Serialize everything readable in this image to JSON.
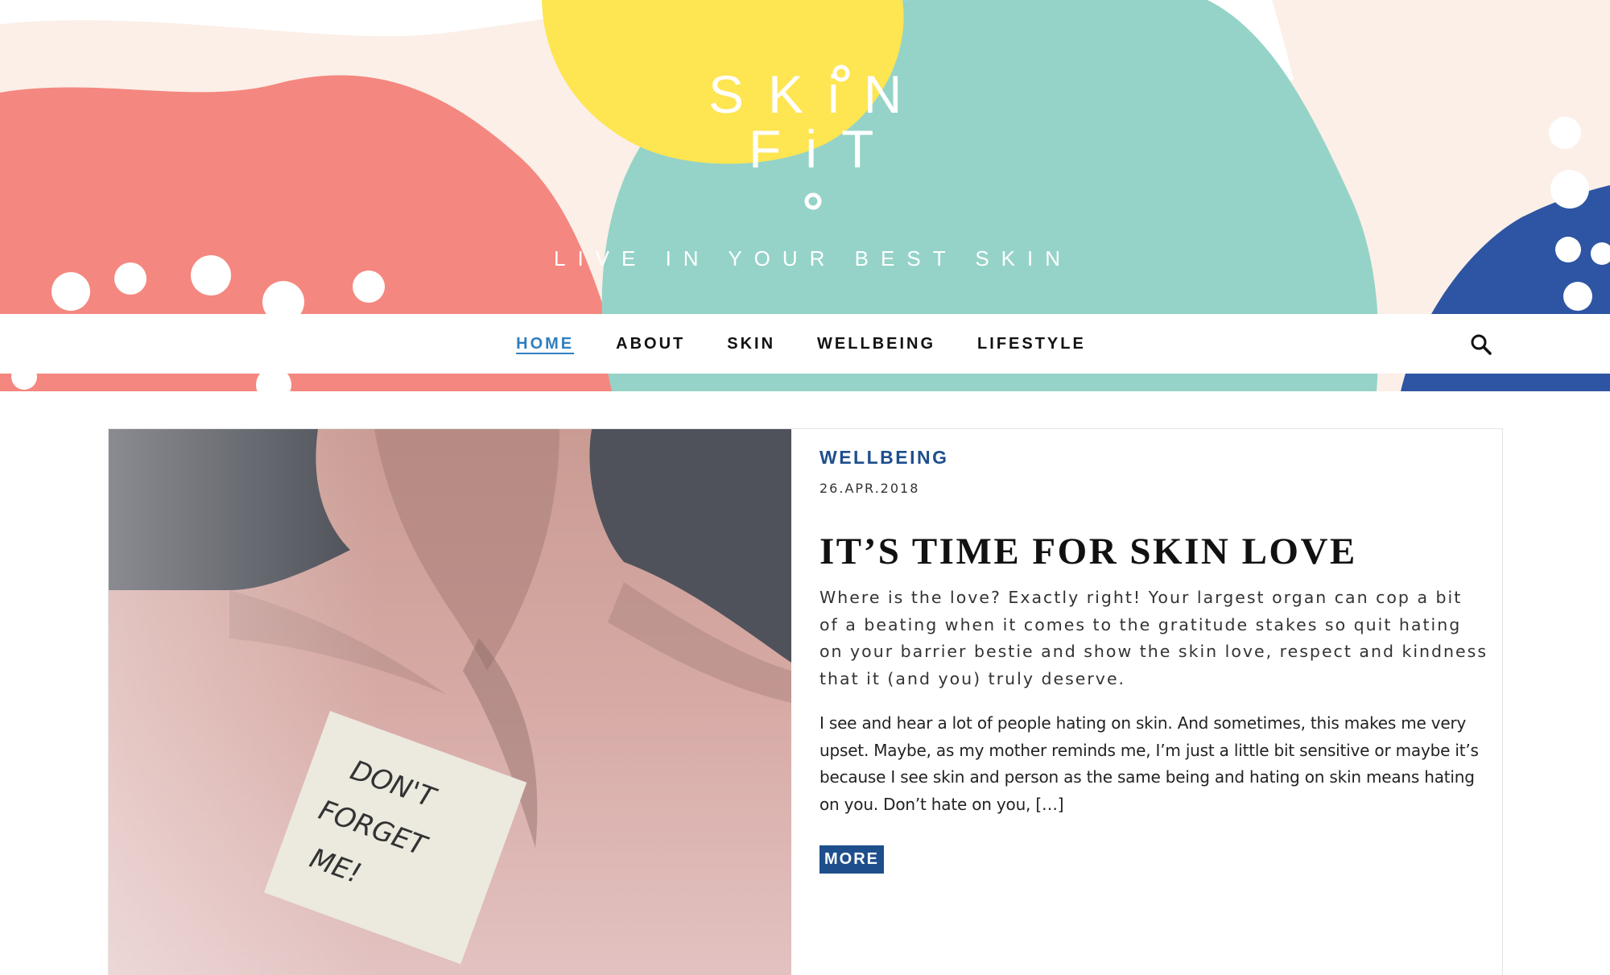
{
  "site": {
    "logo_text_line1": "SKiN",
    "logo_text_line2": "FiT",
    "tagline": "LIVE IN YOUR BEST SKIN"
  },
  "nav": {
    "items": [
      {
        "label": "HOME",
        "active": true
      },
      {
        "label": "ABOUT",
        "active": false
      },
      {
        "label": "SKIN",
        "active": false
      },
      {
        "label": "WELLBEING",
        "active": false
      },
      {
        "label": "LIFESTYLE",
        "active": false
      }
    ],
    "search_icon": "search-icon"
  },
  "post": {
    "category": "WELLBEING",
    "date": "26.APR.2018",
    "title": "IT’S TIME FOR SKIN LOVE",
    "lead": "Where is the love? Exactly right! Your largest organ can cop a bit of a beating when it comes to the gratitude stakes so quit hating on your barrier bestie and show the skin love, respect and kindness that it (and you) truly deserve.",
    "excerpt": "I see and hear a lot of people hating on skin. And sometimes, this makes me very upset. Maybe, as my mother reminds me, I’m just a little bit sensitive or maybe it’s because I see skin and person as the same being and hating on skin means hating on you. Don’t hate on you, […]",
    "more_label": "MORE",
    "image_note": "DON'T FORGET ME!"
  },
  "colors": {
    "coral": "#f4877f",
    "mint": "#95d3c8",
    "yellow": "#fee552",
    "navy": "#2d55a3",
    "blush": "#fbefe8",
    "accent_blue": "#1e4f8c",
    "nav_active": "#2f7fbf"
  }
}
